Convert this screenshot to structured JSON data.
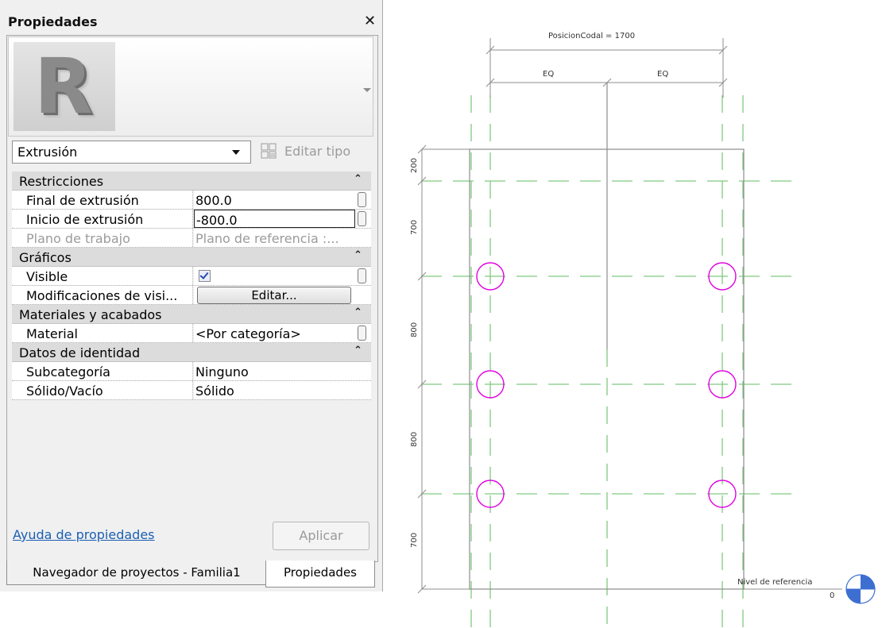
{
  "panel": {
    "title": "Propiedades",
    "close_glyph": "✕",
    "logo_letter": "R",
    "type_selector": "Extrusión",
    "edit_type_label": "Editar tipo",
    "help_link": "Ayuda de propiedades",
    "apply_label": "Aplicar",
    "categories": [
      {
        "label": "Restricciones",
        "rows": [
          {
            "name": "Final de extrusión",
            "value": "800.0"
          },
          {
            "name": "Inicio de extrusión",
            "value": "-800.0"
          },
          {
            "name": "Plano de trabajo",
            "value": "Plano de referencia :..."
          }
        ]
      },
      {
        "label": "Gráficos",
        "rows": [
          {
            "name": "Visible",
            "value": "checked"
          },
          {
            "name": "Modificaciones de visi...",
            "value": "Editar..."
          }
        ]
      },
      {
        "label": "Materiales y acabados",
        "rows": [
          {
            "name": "Material",
            "value": "<Por categoría>"
          }
        ]
      },
      {
        "label": "Datos de identidad",
        "rows": [
          {
            "name": "Subcategoría",
            "value": "Ninguno"
          },
          {
            "name": "Sólido/Vacío",
            "value": "Sólido"
          }
        ]
      }
    ],
    "tabs": [
      "Navegador de proyectos - Familia1",
      "Propiedades"
    ]
  },
  "drawing": {
    "top_dimension": "PosicionCodal = 1700",
    "eq_labels": [
      "EQ",
      "EQ"
    ],
    "vertical_dims": [
      "200",
      "700",
      "800",
      "800",
      "700"
    ],
    "level_name": "Nivel de referencia",
    "level_value": "0",
    "colors": {
      "ref_plane": "#7fc97f",
      "circle": "#e000e0",
      "line": "#8c8c8c"
    }
  }
}
